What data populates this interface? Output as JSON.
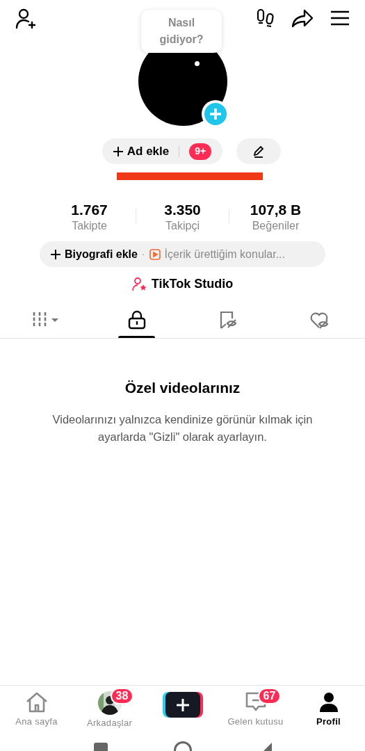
{
  "speech_bubble": {
    "text": "Nasıl gidiyor?"
  },
  "profile_actions": {
    "add_name": "Ad ekle",
    "badge": "9+"
  },
  "stats": [
    {
      "value": "1.767",
      "label": "Takipte"
    },
    {
      "value": "3.350",
      "label": "Takipçi"
    },
    {
      "value": "107,8 B",
      "label": "Beğeniler"
    }
  ],
  "bio": {
    "add_label": "Biyografi ekle",
    "separator": "·",
    "hint": "İçerik ürettiğim konular..."
  },
  "studio_link": "TikTok Studio",
  "tabs": [
    {
      "kind": "grid",
      "selected": false
    },
    {
      "kind": "private",
      "selected": true
    },
    {
      "kind": "saved",
      "selected": false
    },
    {
      "kind": "liked",
      "selected": false
    }
  ],
  "empty_state": {
    "title": "Özel videolarınız",
    "message": "Videolarınızı yalnızca kendinize görünür kılmak için ayarlarda \"Gizli\" olarak ayarlayın."
  },
  "bottom_nav": [
    {
      "kind": "home",
      "label": "Ana sayfa",
      "selected": false
    },
    {
      "kind": "friends",
      "label": "Arkadaşlar",
      "badge": "38",
      "selected": false
    },
    {
      "kind": "create",
      "selected": false
    },
    {
      "kind": "inbox",
      "label": "Gelen kutusu",
      "badge": "67",
      "selected": false
    },
    {
      "kind": "profile",
      "label": "Profil",
      "selected": true
    }
  ]
}
